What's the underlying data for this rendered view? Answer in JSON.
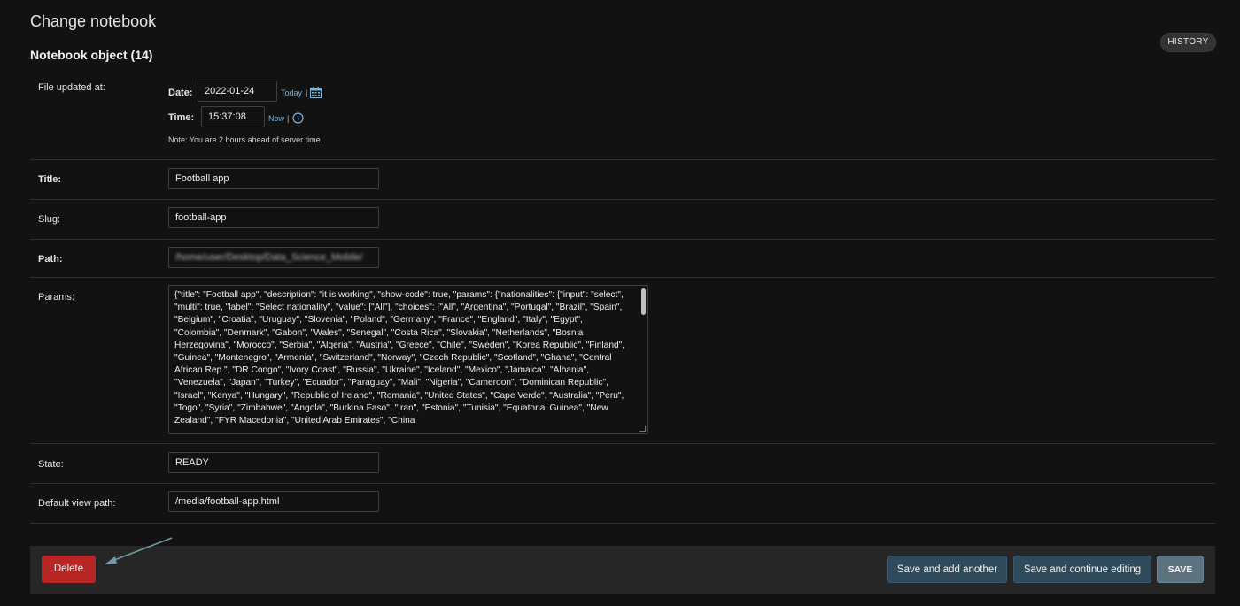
{
  "header": {
    "page_title": "Change notebook",
    "object_title": "Notebook object (14)",
    "history_label": "HISTORY"
  },
  "fields": {
    "file_updated": {
      "label": "File updated at:",
      "date_label": "Date:",
      "date_value": "2022-01-24",
      "today_link": "Today",
      "time_label": "Time:",
      "time_value": "15:37:08",
      "now_link": "Now",
      "separator": "|",
      "note": "Note: You are 2 hours ahead of server time."
    },
    "title": {
      "label": "Title:",
      "value": "Football app"
    },
    "slug": {
      "label": "Slug:",
      "value": "football-app"
    },
    "path": {
      "label": "Path:",
      "value": "/home/user/Desktop/Data_Science_Mobile/"
    },
    "params": {
      "label": "Params:",
      "value": "{\"title\": \"Football app\", \"description\": \"it is working\", \"show-code\": true, \"params\": {\"nationalities\": {\"input\": \"select\", \"multi\": true, \"label\": \"Select nationality\", \"value\": [\"All\"], \"choices\": [\"All\", \"Argentina\", \"Portugal\", \"Brazil\", \"Spain\", \"Belgium\", \"Croatia\", \"Uruguay\", \"Slovenia\", \"Poland\", \"Germany\", \"France\", \"England\", \"Italy\", \"Egypt\", \"Colombia\", \"Denmark\", \"Gabon\", \"Wales\", \"Senegal\", \"Costa Rica\", \"Slovakia\", \"Netherlands\", \"Bosnia Herzegovina\", \"Morocco\", \"Serbia\", \"Algeria\", \"Austria\", \"Greece\", \"Chile\", \"Sweden\", \"Korea Republic\", \"Finland\", \"Guinea\", \"Montenegro\", \"Armenia\", \"Switzerland\", \"Norway\", \"Czech Republic\", \"Scotland\", \"Ghana\", \"Central African Rep.\", \"DR Congo\", \"Ivory Coast\", \"Russia\", \"Ukraine\", \"Iceland\", \"Mexico\", \"Jamaica\", \"Albania\", \"Venezuela\", \"Japan\", \"Turkey\", \"Ecuador\", \"Paraguay\", \"Mali\", \"Nigeria\", \"Cameroon\", \"Dominican Republic\", \"Israel\", \"Kenya\", \"Hungary\", \"Republic of Ireland\", \"Romania\", \"United States\", \"Cape Verde\", \"Australia\", \"Peru\", \"Togo\", \"Syria\", \"Zimbabwe\", \"Angola\", \"Burkina Faso\", \"Iran\", \"Estonia\", \"Tunisia\", \"Equatorial Guinea\", \"New Zealand\", \"FYR Macedonia\", \"United Arab Emirates\", \"China"
    },
    "state": {
      "label": "State:",
      "value": "READY"
    },
    "default_view_path": {
      "label": "Default view path:",
      "value": "/media/football-app.html"
    }
  },
  "actions": {
    "delete_label": "Delete",
    "save_add_another_label": "Save and add another",
    "save_continue_label": "Save and continue editing",
    "save_label": "SAVE"
  },
  "colors": {
    "background": "#121212",
    "delete": "#b72525",
    "button_blue": "#2f4a5b",
    "save": "#5d7380",
    "link": "#7ab4d8"
  },
  "icons": [
    "calendar-icon",
    "clock-icon",
    "arrow-annotation-icon"
  ]
}
